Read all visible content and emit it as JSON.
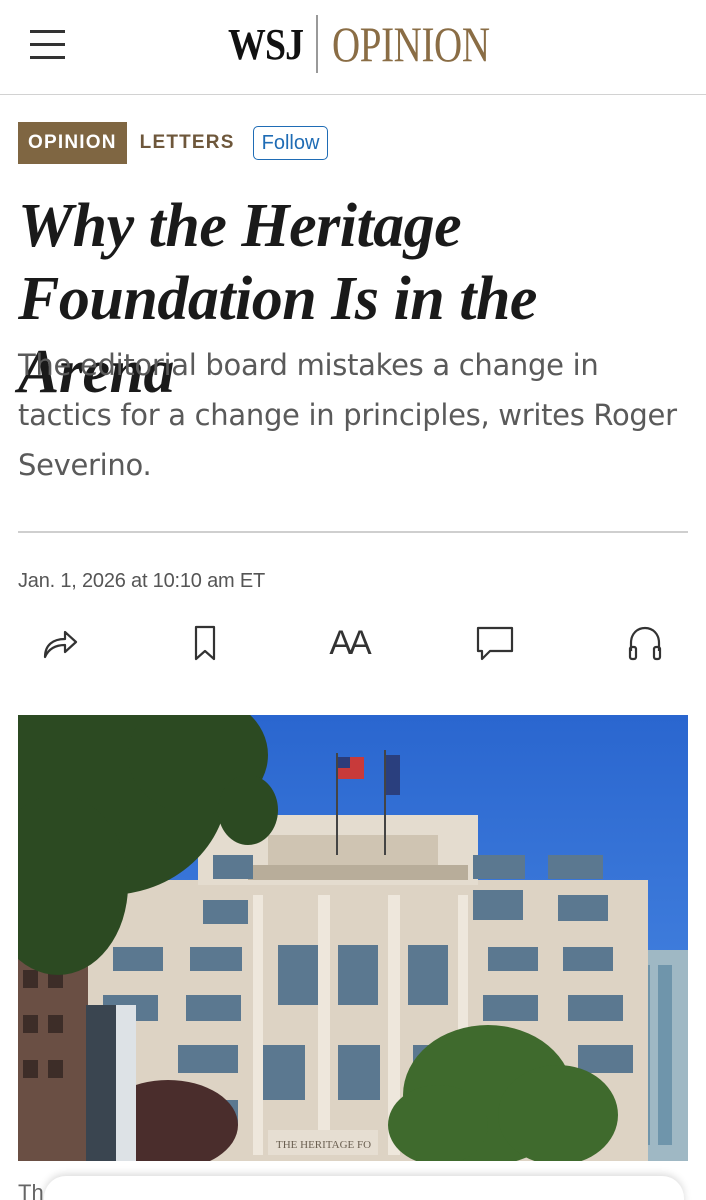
{
  "header": {
    "menu_icon": "hamburger-menu-icon",
    "logo_wsj": "WSJ",
    "logo_section": "OPINION"
  },
  "section": {
    "tag": "OPINION",
    "subsection": "LETTERS",
    "follow_label": "Follow"
  },
  "article": {
    "headline": "Why the Heritage Foundation Is in the Arena",
    "dek": "The editorial board mistakes a change in tactics for a change in principles, writes Roger Severino.",
    "dateline": "Jan. 1, 2026 at 10:10 am ET",
    "photo_sign": "THE HERITAGE FO",
    "body_start": "Th"
  },
  "toolbar": {
    "share_icon": "share-icon",
    "bookmark_icon": "bookmark-icon",
    "text_size_label": "AA",
    "comment_icon": "comment-icon",
    "listen_icon": "headphones-icon"
  },
  "colors": {
    "brand_gold": "#7f6642",
    "follow_blue": "#1f6cb5"
  }
}
